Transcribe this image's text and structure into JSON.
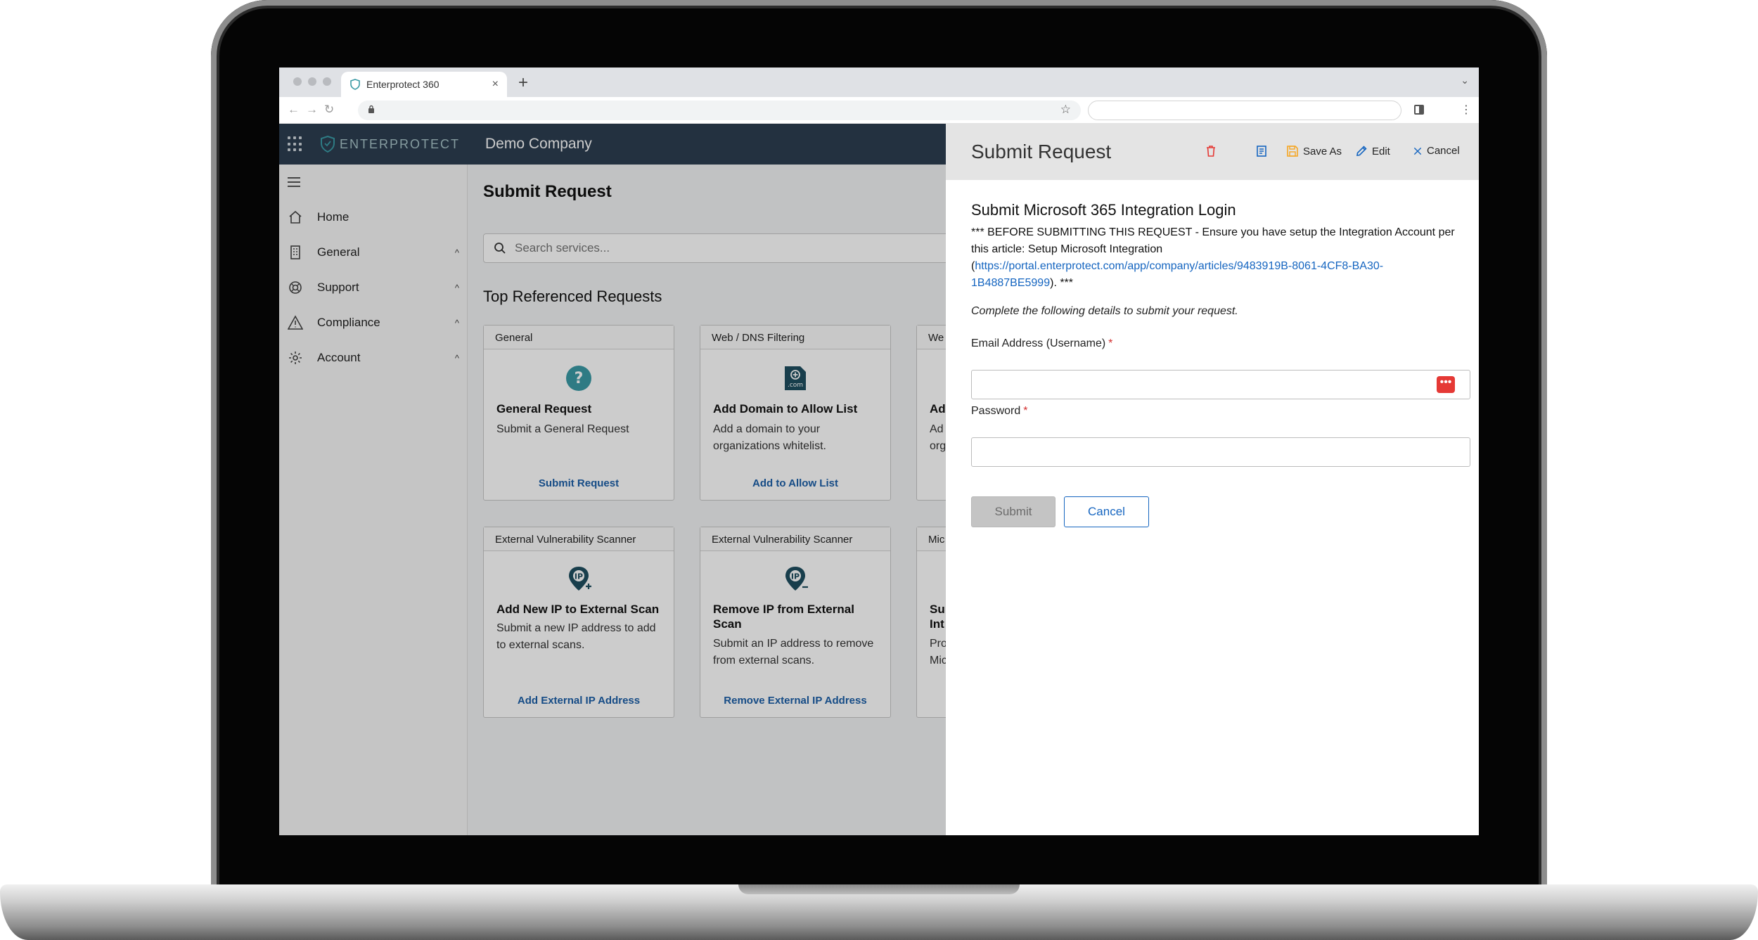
{
  "browser": {
    "tab_title": "Enterprotect 360",
    "new_tab": "+",
    "close_tab": "×",
    "back": "←",
    "forward": "→",
    "reload": "↻",
    "bookmark": "☆",
    "menu": "⋮",
    "tab_list": "⌄"
  },
  "app": {
    "logo_text": "ENTERPROTECT",
    "company": "Demo Company"
  },
  "sidebar": {
    "items": [
      {
        "label": "Home",
        "icon": "home-icon"
      },
      {
        "label": "General",
        "icon": "building-icon",
        "chevron": "^"
      },
      {
        "label": "Support",
        "icon": "lifebuoy-icon",
        "chevron": "^"
      },
      {
        "label": "Compliance",
        "icon": "warning-icon",
        "chevron": "^"
      },
      {
        "label": "Account",
        "icon": "gear-icon",
        "chevron": "^"
      }
    ]
  },
  "main": {
    "title": "Submit Request",
    "search_placeholder": "Search services...",
    "section_title": "Top Referenced Requests",
    "cards": [
      {
        "category": "General",
        "title": "General Request",
        "desc": "Submit a General Request",
        "link": "Submit Request",
        "icon": "question-icon"
      },
      {
        "category": "Web / DNS Filtering",
        "title": "Add Domain to Allow List",
        "desc": "Add a domain to your organizations whitelist.",
        "link": "Add to Allow List",
        "icon": "domain-add-icon",
        "icon_text": ".com"
      },
      {
        "category": "We",
        "title": "Ad",
        "desc": "Ad org",
        "link": ""
      },
      {
        "category": "External Vulnerability Scanner",
        "title": "Add New IP to External Scan",
        "desc": "Submit a new IP address to add to external scans.",
        "link": "Add External IP Address",
        "icon": "ip-add-icon",
        "icon_text": "IP"
      },
      {
        "category": "External Vulnerability Scanner",
        "title": "Remove IP from External Scan",
        "desc": "Submit an IP address to remove from external scans.",
        "link": "Remove External IP Address",
        "icon": "ip-remove-icon",
        "icon_text": "IP"
      },
      {
        "category": "Mic",
        "title": "Su Int",
        "desc": "Pro Mic",
        "link": ""
      }
    ]
  },
  "panel": {
    "title": "Submit Request",
    "actions": {
      "save_as": "Save As",
      "edit": "Edit",
      "cancel": "Cancel"
    },
    "form_title": "Submit Microsoft 365 Integration Login",
    "notice_before": "*** BEFORE SUBMITTING THIS REQUEST - Ensure you have setup the Integration Account per this article: Setup Microsoft Integration (",
    "notice_link": "https://portal.enterprotect.com/app/company/articles/9483919B-8061-4CF8-BA30-1B4887BE5999",
    "notice_after": "). ***",
    "instructions": "Complete the following details to submit your request.",
    "email_label": "Email Address (Username)",
    "password_label": "Password",
    "required_mark": "*",
    "password_manager_glyph": "•••",
    "submit_label": "Submit",
    "cancel_label": "Cancel"
  },
  "colors": {
    "nav_bg": "#2c3e50",
    "link_blue": "#1c5fa8",
    "danger_red": "#e53935",
    "icon_teal": "#3a9aa5",
    "icon_dark": "#1f4e5f"
  }
}
